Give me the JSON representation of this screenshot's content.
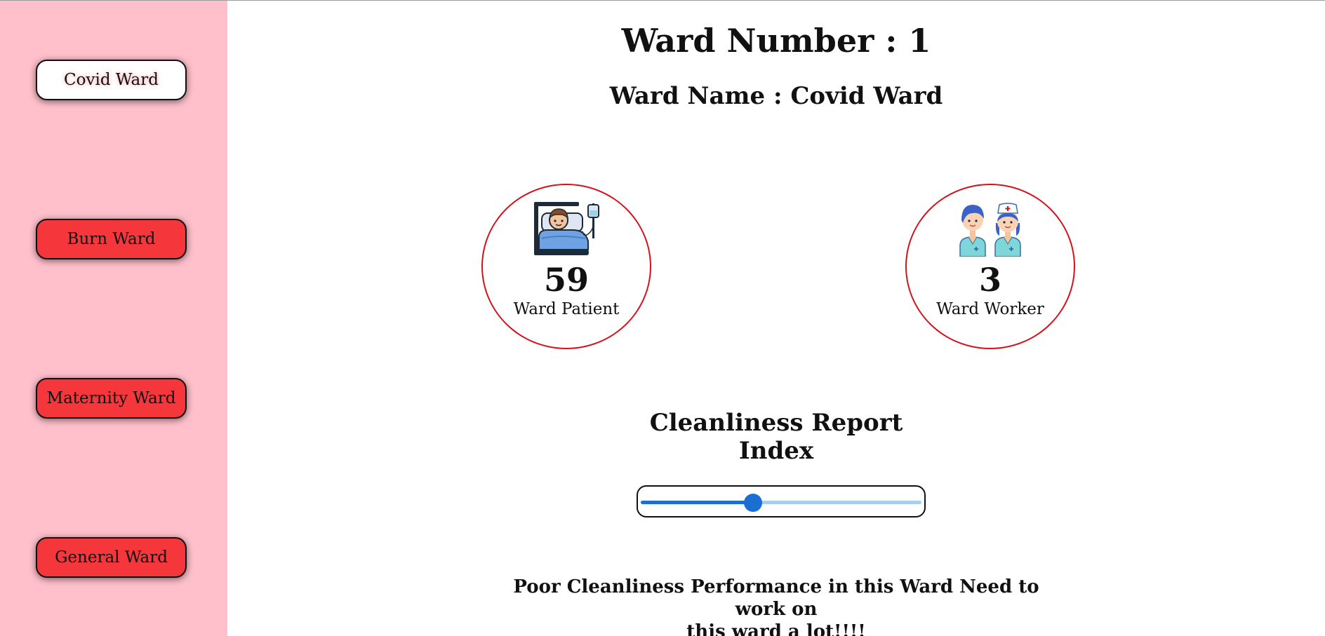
{
  "sidebar": {
    "items": [
      {
        "label": "Covid Ward",
        "active": true
      },
      {
        "label": "Burn Ward",
        "active": false
      },
      {
        "label": "Maternity Ward",
        "active": false
      },
      {
        "label": "General Ward",
        "active": false
      }
    ]
  },
  "header": {
    "title": "Ward Number : 1",
    "subtitle": "Ward Name : Covid Ward"
  },
  "stats": {
    "patient": {
      "value": "59",
      "label": "Ward Patient",
      "icon": "patient-in-bed-icon"
    },
    "worker": {
      "value": "3",
      "label": "Ward Worker",
      "icon": "medical-workers-icon"
    }
  },
  "cleanliness": {
    "title_line1": "Cleanliness Report",
    "title_line2": "Index",
    "slider_fraction": 0.4,
    "message_line1": "Poor Cleanliness Performance in this Ward Need to work on",
    "message_line2": "this ward a lot!!!!"
  },
  "colors": {
    "sidebar_bg": "#ffc0cb",
    "button_red": "#f5363b",
    "circle_border": "#d4121d",
    "slider_blue": "#1b6fd2"
  }
}
